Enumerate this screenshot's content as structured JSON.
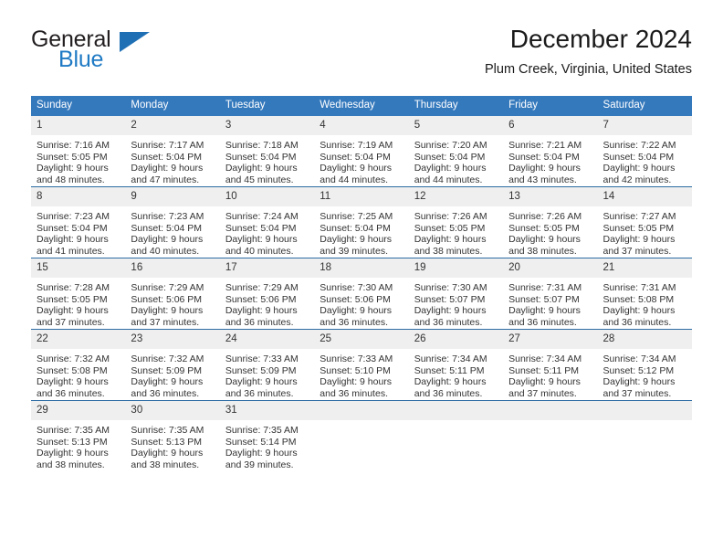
{
  "brand": {
    "name_top": "General",
    "name_bottom": "Blue",
    "triangle_icon": "blue-triangle-icon",
    "color_dark": "#231f20",
    "color_blue": "#1f7ac4"
  },
  "header": {
    "title": "December 2024",
    "subtitle": "Plum Creek, Virginia, United States"
  },
  "theme": {
    "header_blue": "#3579bd",
    "row_divider_blue": "#2e6da4",
    "daynum_band": "#efefef",
    "text": "#333333"
  },
  "weekdays": [
    "Sunday",
    "Monday",
    "Tuesday",
    "Wednesday",
    "Thursday",
    "Friday",
    "Saturday"
  ],
  "weeks": [
    [
      {
        "day": "1",
        "sunrise": "Sunrise: 7:16 AM",
        "sunset": "Sunset: 5:05 PM",
        "daylight1": "Daylight: 9 hours",
        "daylight2": "and 48 minutes."
      },
      {
        "day": "2",
        "sunrise": "Sunrise: 7:17 AM",
        "sunset": "Sunset: 5:04 PM",
        "daylight1": "Daylight: 9 hours",
        "daylight2": "and 47 minutes."
      },
      {
        "day": "3",
        "sunrise": "Sunrise: 7:18 AM",
        "sunset": "Sunset: 5:04 PM",
        "daylight1": "Daylight: 9 hours",
        "daylight2": "and 45 minutes."
      },
      {
        "day": "4",
        "sunrise": "Sunrise: 7:19 AM",
        "sunset": "Sunset: 5:04 PM",
        "daylight1": "Daylight: 9 hours",
        "daylight2": "and 44 minutes."
      },
      {
        "day": "5",
        "sunrise": "Sunrise: 7:20 AM",
        "sunset": "Sunset: 5:04 PM",
        "daylight1": "Daylight: 9 hours",
        "daylight2": "and 44 minutes."
      },
      {
        "day": "6",
        "sunrise": "Sunrise: 7:21 AM",
        "sunset": "Sunset: 5:04 PM",
        "daylight1": "Daylight: 9 hours",
        "daylight2": "and 43 minutes."
      },
      {
        "day": "7",
        "sunrise": "Sunrise: 7:22 AM",
        "sunset": "Sunset: 5:04 PM",
        "daylight1": "Daylight: 9 hours",
        "daylight2": "and 42 minutes."
      }
    ],
    [
      {
        "day": "8",
        "sunrise": "Sunrise: 7:23 AM",
        "sunset": "Sunset: 5:04 PM",
        "daylight1": "Daylight: 9 hours",
        "daylight2": "and 41 minutes."
      },
      {
        "day": "9",
        "sunrise": "Sunrise: 7:23 AM",
        "sunset": "Sunset: 5:04 PM",
        "daylight1": "Daylight: 9 hours",
        "daylight2": "and 40 minutes."
      },
      {
        "day": "10",
        "sunrise": "Sunrise: 7:24 AM",
        "sunset": "Sunset: 5:04 PM",
        "daylight1": "Daylight: 9 hours",
        "daylight2": "and 40 minutes."
      },
      {
        "day": "11",
        "sunrise": "Sunrise: 7:25 AM",
        "sunset": "Sunset: 5:04 PM",
        "daylight1": "Daylight: 9 hours",
        "daylight2": "and 39 minutes."
      },
      {
        "day": "12",
        "sunrise": "Sunrise: 7:26 AM",
        "sunset": "Sunset: 5:05 PM",
        "daylight1": "Daylight: 9 hours",
        "daylight2": "and 38 minutes."
      },
      {
        "day": "13",
        "sunrise": "Sunrise: 7:26 AM",
        "sunset": "Sunset: 5:05 PM",
        "daylight1": "Daylight: 9 hours",
        "daylight2": "and 38 minutes."
      },
      {
        "day": "14",
        "sunrise": "Sunrise: 7:27 AM",
        "sunset": "Sunset: 5:05 PM",
        "daylight1": "Daylight: 9 hours",
        "daylight2": "and 37 minutes."
      }
    ],
    [
      {
        "day": "15",
        "sunrise": "Sunrise: 7:28 AM",
        "sunset": "Sunset: 5:05 PM",
        "daylight1": "Daylight: 9 hours",
        "daylight2": "and 37 minutes."
      },
      {
        "day": "16",
        "sunrise": "Sunrise: 7:29 AM",
        "sunset": "Sunset: 5:06 PM",
        "daylight1": "Daylight: 9 hours",
        "daylight2": "and 37 minutes."
      },
      {
        "day": "17",
        "sunrise": "Sunrise: 7:29 AM",
        "sunset": "Sunset: 5:06 PM",
        "daylight1": "Daylight: 9 hours",
        "daylight2": "and 36 minutes."
      },
      {
        "day": "18",
        "sunrise": "Sunrise: 7:30 AM",
        "sunset": "Sunset: 5:06 PM",
        "daylight1": "Daylight: 9 hours",
        "daylight2": "and 36 minutes."
      },
      {
        "day": "19",
        "sunrise": "Sunrise: 7:30 AM",
        "sunset": "Sunset: 5:07 PM",
        "daylight1": "Daylight: 9 hours",
        "daylight2": "and 36 minutes."
      },
      {
        "day": "20",
        "sunrise": "Sunrise: 7:31 AM",
        "sunset": "Sunset: 5:07 PM",
        "daylight1": "Daylight: 9 hours",
        "daylight2": "and 36 minutes."
      },
      {
        "day": "21",
        "sunrise": "Sunrise: 7:31 AM",
        "sunset": "Sunset: 5:08 PM",
        "daylight1": "Daylight: 9 hours",
        "daylight2": "and 36 minutes."
      }
    ],
    [
      {
        "day": "22",
        "sunrise": "Sunrise: 7:32 AM",
        "sunset": "Sunset: 5:08 PM",
        "daylight1": "Daylight: 9 hours",
        "daylight2": "and 36 minutes."
      },
      {
        "day": "23",
        "sunrise": "Sunrise: 7:32 AM",
        "sunset": "Sunset: 5:09 PM",
        "daylight1": "Daylight: 9 hours",
        "daylight2": "and 36 minutes."
      },
      {
        "day": "24",
        "sunrise": "Sunrise: 7:33 AM",
        "sunset": "Sunset: 5:09 PM",
        "daylight1": "Daylight: 9 hours",
        "daylight2": "and 36 minutes."
      },
      {
        "day": "25",
        "sunrise": "Sunrise: 7:33 AM",
        "sunset": "Sunset: 5:10 PM",
        "daylight1": "Daylight: 9 hours",
        "daylight2": "and 36 minutes."
      },
      {
        "day": "26",
        "sunrise": "Sunrise: 7:34 AM",
        "sunset": "Sunset: 5:11 PM",
        "daylight1": "Daylight: 9 hours",
        "daylight2": "and 36 minutes."
      },
      {
        "day": "27",
        "sunrise": "Sunrise: 7:34 AM",
        "sunset": "Sunset: 5:11 PM",
        "daylight1": "Daylight: 9 hours",
        "daylight2": "and 37 minutes."
      },
      {
        "day": "28",
        "sunrise": "Sunrise: 7:34 AM",
        "sunset": "Sunset: 5:12 PM",
        "daylight1": "Daylight: 9 hours",
        "daylight2": "and 37 minutes."
      }
    ],
    [
      {
        "day": "29",
        "sunrise": "Sunrise: 7:35 AM",
        "sunset": "Sunset: 5:13 PM",
        "daylight1": "Daylight: 9 hours",
        "daylight2": "and 38 minutes."
      },
      {
        "day": "30",
        "sunrise": "Sunrise: 7:35 AM",
        "sunset": "Sunset: 5:13 PM",
        "daylight1": "Daylight: 9 hours",
        "daylight2": "and 38 minutes."
      },
      {
        "day": "31",
        "sunrise": "Sunrise: 7:35 AM",
        "sunset": "Sunset: 5:14 PM",
        "daylight1": "Daylight: 9 hours",
        "daylight2": "and 39 minutes."
      },
      {
        "day": "",
        "sunrise": "",
        "sunset": "",
        "daylight1": "",
        "daylight2": ""
      },
      {
        "day": "",
        "sunrise": "",
        "sunset": "",
        "daylight1": "",
        "daylight2": ""
      },
      {
        "day": "",
        "sunrise": "",
        "sunset": "",
        "daylight1": "",
        "daylight2": ""
      },
      {
        "day": "",
        "sunrise": "",
        "sunset": "",
        "daylight1": "",
        "daylight2": ""
      }
    ]
  ]
}
